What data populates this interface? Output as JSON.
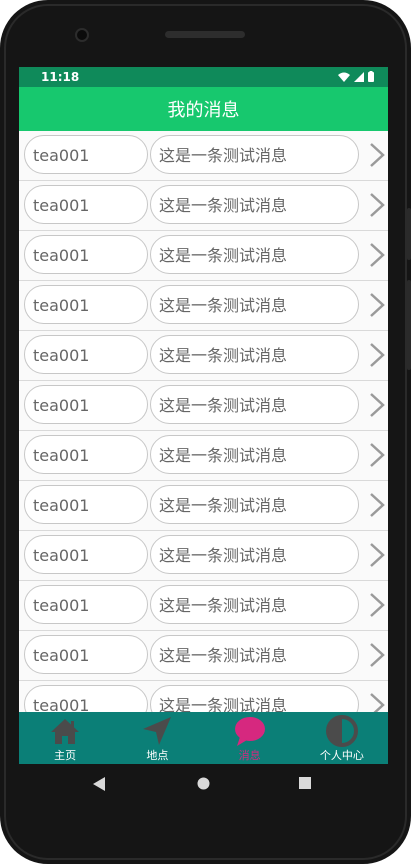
{
  "status": {
    "time": "11:18"
  },
  "app": {
    "title": "我的消息"
  },
  "messages": [
    {
      "sender": "tea001",
      "text": "这是一条测试消息"
    },
    {
      "sender": "tea001",
      "text": "这是一条测试消息"
    },
    {
      "sender": "tea001",
      "text": "这是一条测试消息"
    },
    {
      "sender": "tea001",
      "text": "这是一条测试消息"
    },
    {
      "sender": "tea001",
      "text": "这是一条测试消息"
    },
    {
      "sender": "tea001",
      "text": "这是一条测试消息"
    },
    {
      "sender": "tea001",
      "text": "这是一条测试消息"
    },
    {
      "sender": "tea001",
      "text": "这是一条测试消息"
    },
    {
      "sender": "tea001",
      "text": "这是一条测试消息"
    },
    {
      "sender": "tea001",
      "text": "这是一条测试消息"
    },
    {
      "sender": "tea001",
      "text": "这是一条测试消息"
    },
    {
      "sender": "tea001",
      "text": "这是一条测试消息"
    }
  ],
  "nav": {
    "items": [
      {
        "label": "主页",
        "icon": "home-icon"
      },
      {
        "label": "地点",
        "icon": "navigation-arrow-icon"
      },
      {
        "label": "消息",
        "icon": "chat-bubble-icon",
        "active": true
      },
      {
        "label": "个人中心",
        "icon": "half-circle-icon"
      }
    ]
  },
  "colors": {
    "status_bar": "#0f8a5a",
    "app_bar": "#17c86e",
    "bottom_nav": "#0b7f77",
    "active": "#d6287f"
  }
}
